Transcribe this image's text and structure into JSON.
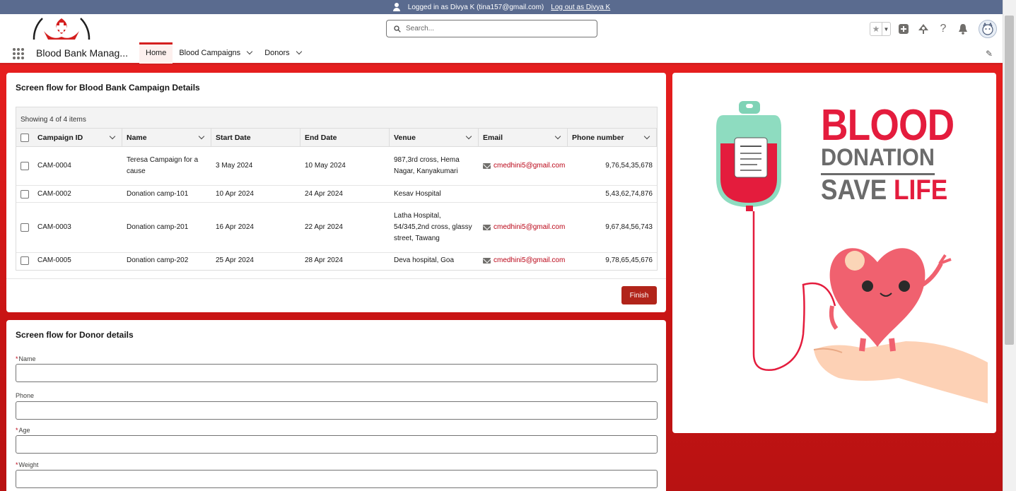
{
  "login_bar": {
    "text": "Logged in as Divya K (tina157@gmail.com)",
    "logout": "Log out as Divya K"
  },
  "search": {
    "placeholder": "Search..."
  },
  "nav": {
    "app_name": "Blood Bank Manag...",
    "tabs": [
      {
        "label": "Home",
        "active": true
      },
      {
        "label": "Blood Campaigns"
      },
      {
        "label": "Donors"
      }
    ]
  },
  "campaign_card": {
    "title": "Screen flow for Blood Bank Campaign Details",
    "status": "Showing 4 of 4 items",
    "columns": [
      "Campaign ID",
      "Name",
      "Start Date",
      "End Date",
      "Venue",
      "Email",
      "Phone number"
    ],
    "rows": [
      {
        "id": "CAM-0004",
        "name": "Teresa Campaign for a cause",
        "start": "3 May 2024",
        "end": "10 May 2024",
        "venue": "987,3rd cross, Hema Nagar, Kanyakumari",
        "email": "cmedhini5@gmail.com",
        "phone": "9,76,54,35,678"
      },
      {
        "id": "CAM-0002",
        "name": "Donation camp-101",
        "start": "10 Apr 2024",
        "end": "24 Apr 2024",
        "venue": "Kesav Hospital",
        "email": "",
        "phone": "5,43,62,74,876"
      },
      {
        "id": "CAM-0003",
        "name": "Donation camp-201",
        "start": "16 Apr 2024",
        "end": "22 Apr 2024",
        "venue": "Latha Hospital, 54/345,2nd cross, glassy street, Tawang",
        "email": "cmedhini5@gmail.com",
        "phone": "9,67,84,56,743"
      },
      {
        "id": "CAM-0005",
        "name": "Donation camp-202",
        "start": "25 Apr 2024",
        "end": "28 Apr 2024",
        "venue": "Deva hospital, Goa",
        "email": "cmedhini5@gmail.com",
        "phone": "9,78,65,45,676"
      }
    ],
    "finish_label": "Finish"
  },
  "donor_card": {
    "title": "Screen flow for Donor details",
    "fields": [
      {
        "label": "Name",
        "required": true,
        "value": ""
      },
      {
        "label": "Phone",
        "required": false,
        "value": ""
      },
      {
        "label": "Age",
        "required": true,
        "value": ""
      },
      {
        "label": "Weight",
        "required": true,
        "value": ""
      }
    ]
  },
  "graphic": {
    "line1": "BLOOD",
    "line2": "DONATION",
    "line3a": "SAVE ",
    "line3b": "LIFE"
  },
  "colors": {
    "brand_red": "#d41f1f",
    "finish_button": "#b1241a",
    "login_bar": "#5a6b8f",
    "link_red": "#ba0517"
  }
}
